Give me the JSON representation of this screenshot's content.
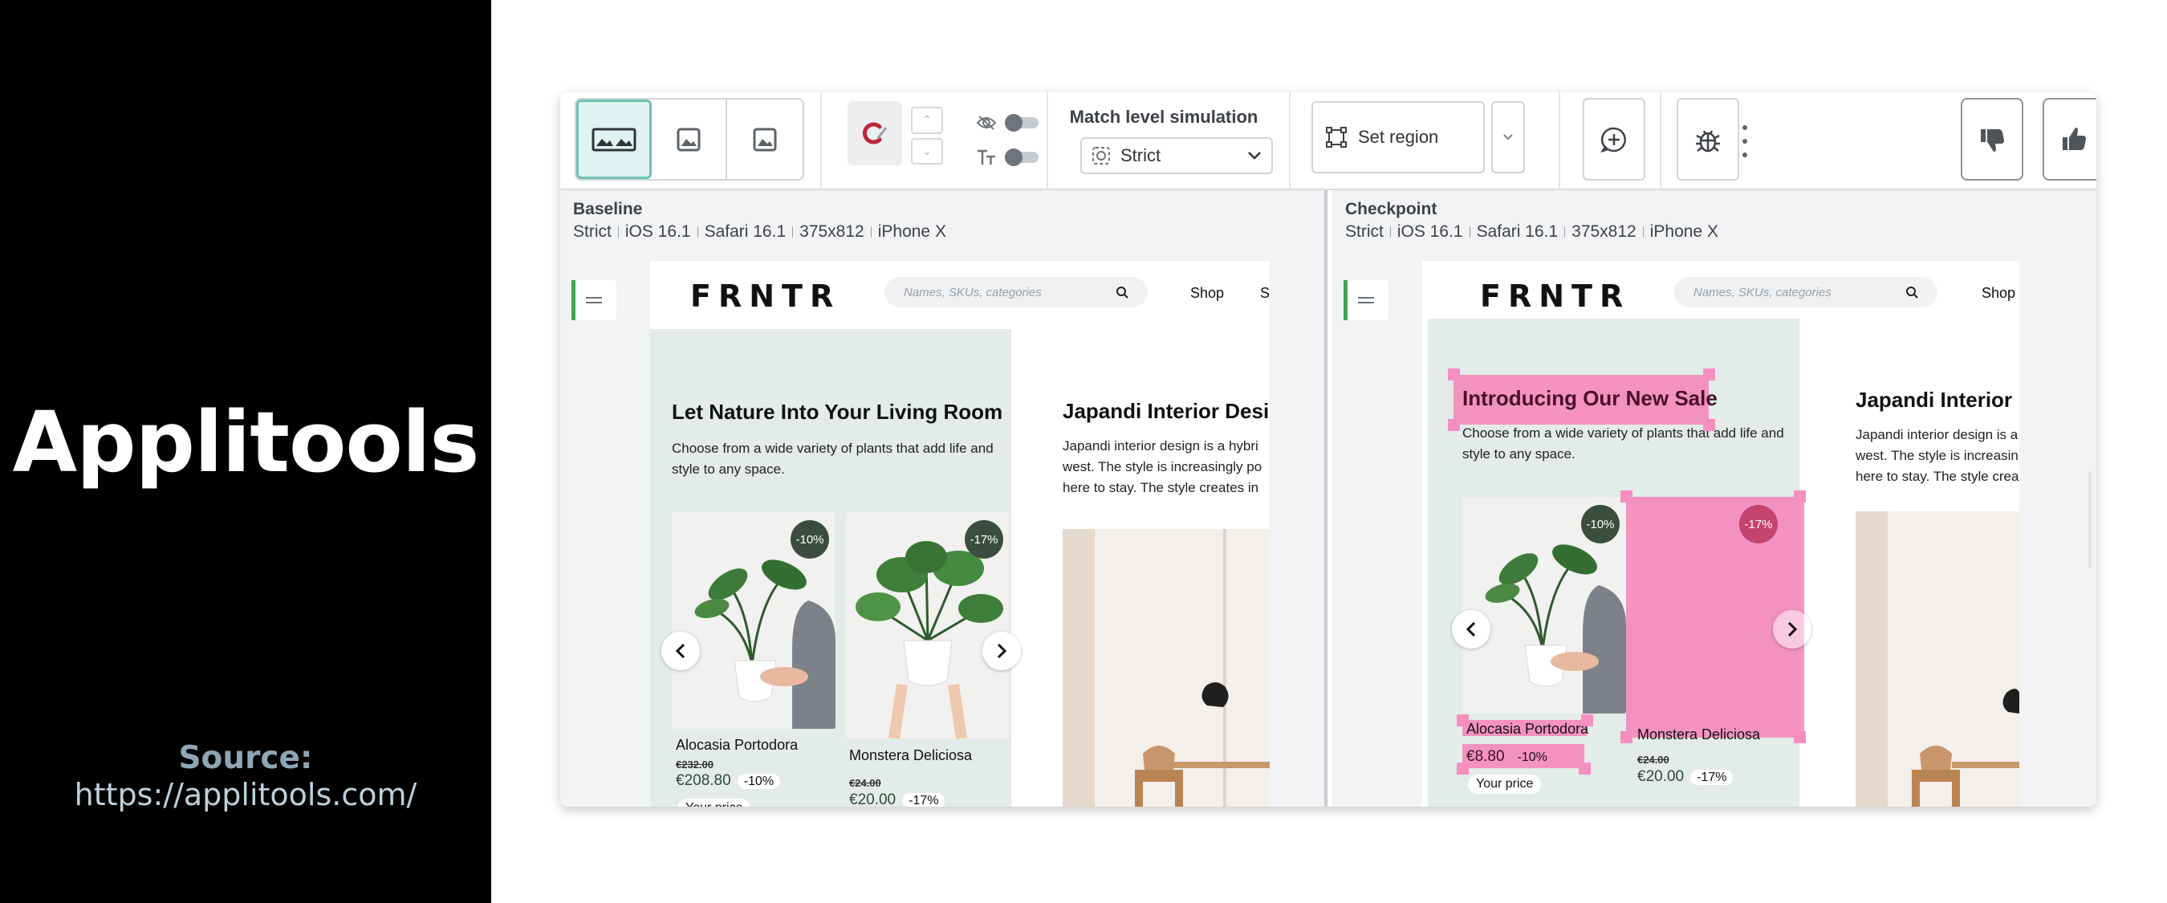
{
  "slide": {
    "brand_title": "Applitools",
    "source_label": "Source:",
    "source_url": "https://applitools.com/"
  },
  "toolbar": {
    "match_level_label": "Match level simulation",
    "match_level_value": "Strict",
    "set_region_label": "Set region"
  },
  "baseline": {
    "title": "Baseline",
    "meta": [
      "Strict",
      "iOS 16.1",
      "Safari 16.1",
      "375x812",
      "iPhone X"
    ],
    "site": {
      "logo": "FRNTR",
      "search_placeholder": "Names, SKUs, categories",
      "nav_shop": "Shop",
      "nav_more": "S",
      "hero_title": "Let Nature Into Your Living Room",
      "hero_text": "Choose from a wide variety of plants that add life and style to any space.",
      "card1": {
        "badge": "-10%",
        "name": "Alocasia Portodora",
        "old_price": "€232.00",
        "price": "€208.80",
        "discount": "-10%"
      },
      "card2": {
        "badge": "-17%",
        "name": "Monstera Deliciosa",
        "old_price": "€24.00",
        "price": "€20.00",
        "discount": "-17%"
      },
      "your_price": "Your price",
      "side_title": "Japandi Interior Desi",
      "side_text": "Japandi interior design is a hybri west. The style is increasingly po here to stay. The style creates in"
    }
  },
  "checkpoint": {
    "title": "Checkpoint",
    "meta": [
      "Strict",
      "iOS 16.1",
      "Safari 16.1",
      "375x812",
      "iPhone X"
    ],
    "site": {
      "logo": "FRNTR",
      "search_placeholder": "Names, SKUs, categories",
      "nav_shop": "Shop",
      "hero_title": "Introducing Our New Sale",
      "hero_text": "Choose from a wide variety of plants that add life and style to any space.",
      "card1": {
        "badge": "-10%",
        "name": "Alocasia Portodora",
        "price": "€8.80",
        "discount": "-10%"
      },
      "card2": {
        "badge": "-17%",
        "name": "Monstera Deliciosa",
        "old_price": "€24.00",
        "price": "€20.00",
        "discount": "-17%"
      },
      "your_price": "Your price",
      "side_title": "Japandi Interior D",
      "side_text": "Japandi interior design is a west. The style is increasin here to stay. The style crea"
    }
  },
  "colors": {
    "diff_highlight": "#f778b2",
    "accent_teal": "#71c1b7",
    "hero_bg": "#e3ece8",
    "brand_bg": "#000000"
  }
}
